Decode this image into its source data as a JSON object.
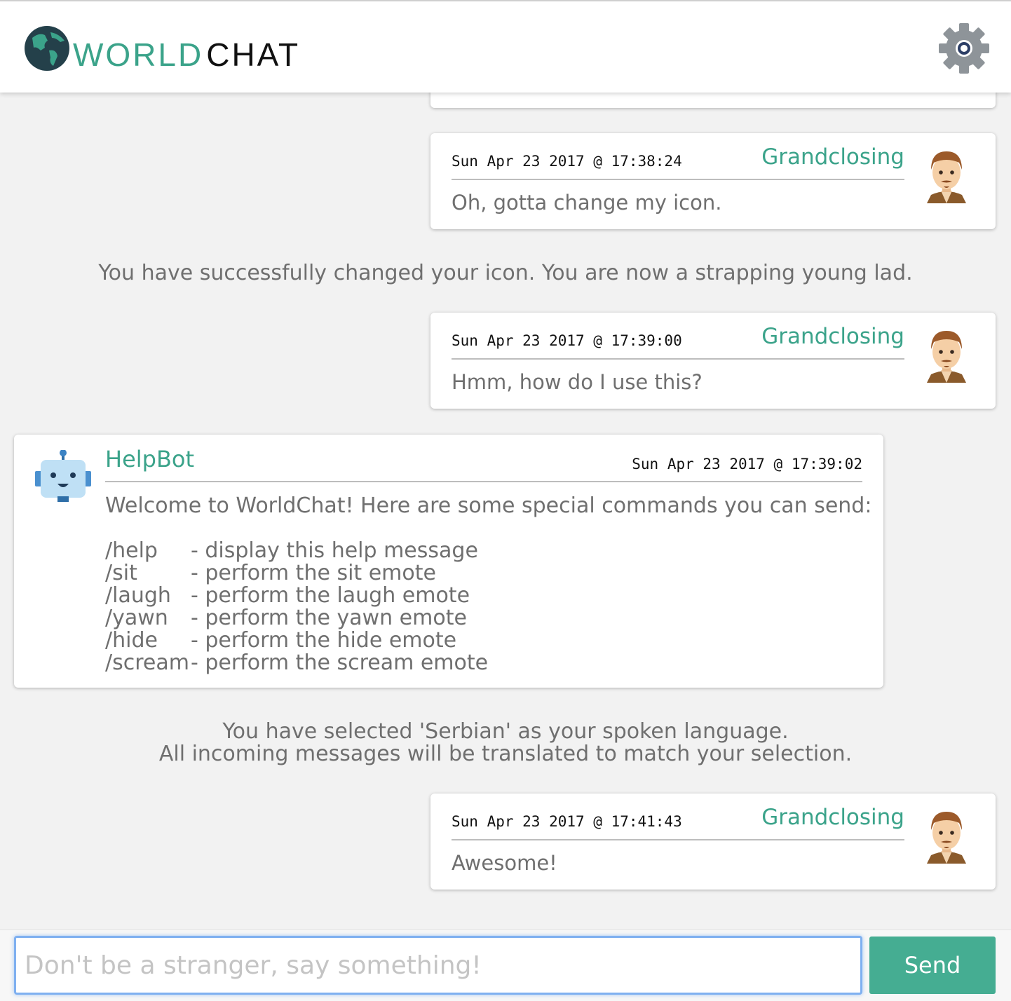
{
  "app": {
    "logo_part1": "WORLD",
    "logo_part2": "CHAT"
  },
  "colors": {
    "accent": "#3ba38a",
    "send_button": "#45ad92",
    "input_focus": "#7fb0f0"
  },
  "icons": {
    "logo": "globe-icon",
    "settings": "gear-icon",
    "user_avatar": "man-avatar-icon",
    "bot_avatar": "robot-icon"
  },
  "messages": [
    {
      "timestamp": "Sun Apr 23 2017 @ 17:38:24",
      "user": "Grandclosing",
      "text": "Oh, gotta change my icon."
    },
    {
      "timestamp": "Sun Apr 23 2017 @ 17:39:00",
      "user": "Grandclosing",
      "text": "Hmm, how do I use this?"
    },
    {
      "timestamp": "Sun Apr 23 2017 @ 17:41:43",
      "user": "Grandclosing",
      "text": "Awesome!"
    }
  ],
  "system_icon": "You have successfully changed your icon. You are now a strapping young lad.",
  "system_language": {
    "line1": "You have selected 'Serbian' as your spoken language.",
    "line2": "All incoming messages will be translated to match your selection."
  },
  "helpbot": {
    "name": "HelpBot",
    "timestamp": "Sun Apr 23 2017 @ 17:39:02",
    "intro": "Welcome to WorldChat! Here are some special commands you can send:",
    "commands": [
      {
        "cmd": "/help",
        "desc": "- display this help message"
      },
      {
        "cmd": "/sit",
        "desc": "- perform the sit emote"
      },
      {
        "cmd": "/laugh",
        "desc": "- perform the laugh emote"
      },
      {
        "cmd": "/yawn",
        "desc": "- perform the yawn emote"
      },
      {
        "cmd": "/hide",
        "desc": "- perform the hide emote"
      },
      {
        "cmd": "/scream",
        "desc": "- perform the scream emote"
      }
    ]
  },
  "composer": {
    "placeholder": "Don't be a stranger, say something!",
    "value": "",
    "send_label": "Send"
  }
}
